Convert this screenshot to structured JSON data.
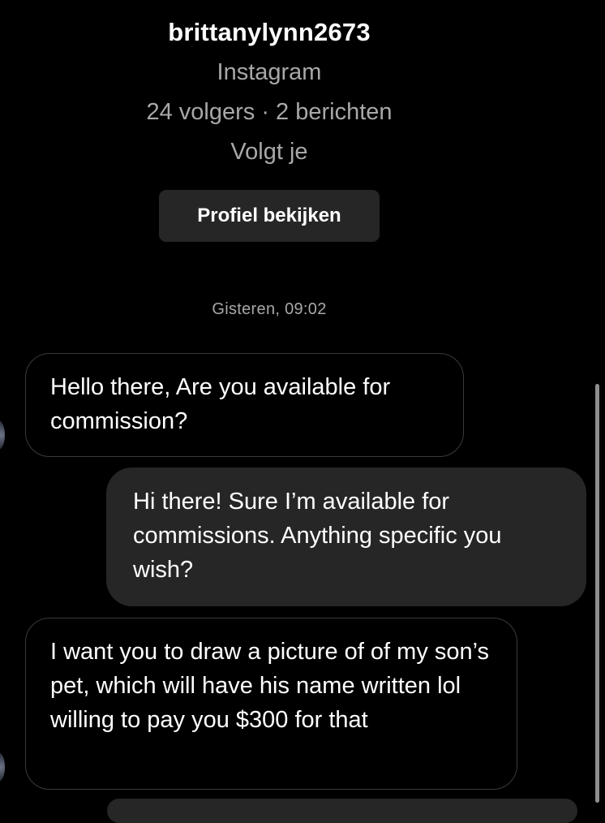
{
  "profile": {
    "username": "brittanylynn2673",
    "platform": "Instagram",
    "stats": "24 volgers · 2 berichten",
    "follow_status": "Volgt je",
    "view_profile_label": "Profiel bekijken"
  },
  "conversation": {
    "timestamp": "Gisteren, 09:02",
    "messages": [
      {
        "direction": "received",
        "text": "Hello there, Are you available for commission?"
      },
      {
        "direction": "sent",
        "text": "Hi there! Sure I’m available for commissions. Anything specific you wish?"
      },
      {
        "direction": "received",
        "text": "I want you to draw a picture of of my son’s pet,  which will have his name written lol willing to pay you $300 for that"
      }
    ]
  },
  "colors": {
    "background": "#000000",
    "sent_bubble": "#262626",
    "received_border": "#3a3a3a",
    "secondary_text": "#a8a8a8"
  }
}
